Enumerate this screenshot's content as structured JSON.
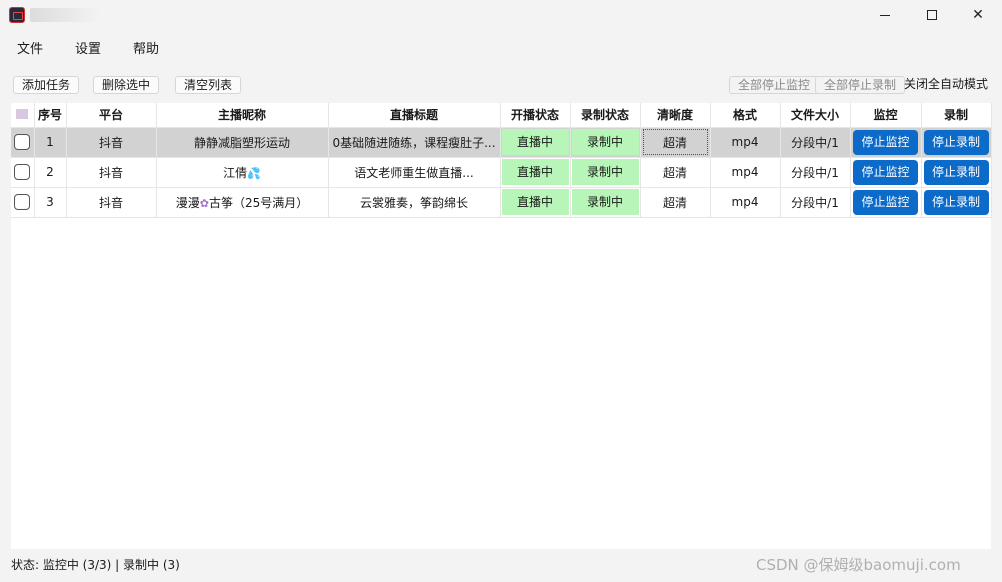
{
  "window": {
    "minimize_icon": "minimize-icon",
    "maximize_icon": "maximize-icon",
    "close_icon": "close-icon"
  },
  "menu": {
    "file": "文件",
    "settings": "设置",
    "help": "帮助"
  },
  "toolbar": {
    "add_task": "添加任务",
    "delete_selected": "删除选中",
    "clear_list": "清空列表",
    "stop_all_monitor": "全部停止监控",
    "stop_all_record": "全部停止录制",
    "close_auto_mode": "关闭全自动模式"
  },
  "table": {
    "headers": [
      "序号",
      "平台",
      "主播昵称",
      "直播标题",
      "开播状态",
      "录制状态",
      "清晰度",
      "格式",
      "文件大小",
      "监控",
      "录制"
    ],
    "rows": [
      {
        "index": "1",
        "platform": "抖音",
        "nickname": "静静减脂塑形运动",
        "nickname_emoji": "",
        "nickname_suffix": "",
        "title": "0基础随进随练，课程瘦肚子...",
        "live_status": "直播中",
        "record_status": "录制中",
        "quality": "超清",
        "format": "mp4",
        "size": "分段中/1",
        "monitor_btn": "停止监控",
        "record_btn": "停止录制"
      },
      {
        "index": "2",
        "platform": "抖音",
        "nickname": "江倩",
        "nickname_emoji": "💦",
        "nickname_suffix": "",
        "title": "语文老师重生做直播...",
        "live_status": "直播中",
        "record_status": "录制中",
        "quality": "超清",
        "format": "mp4",
        "size": "分段中/1",
        "monitor_btn": "停止监控",
        "record_btn": "停止录制"
      },
      {
        "index": "3",
        "platform": "抖音",
        "nickname": "漫漫",
        "nickname_emoji": "✿",
        "nickname_suffix": "古筝（25号满月）",
        "title": "云裳雅奏，筝韵绵长",
        "live_status": "直播中",
        "record_status": "录制中",
        "quality": "超清",
        "format": "mp4",
        "size": "分段中/1",
        "monitor_btn": "停止监控",
        "record_btn": "停止录制"
      }
    ]
  },
  "status": {
    "text": "状态: 监控中 (3/3) | 录制中 (3)"
  },
  "watermark": "CSDN @保姆级baomuji.com",
  "colors": {
    "accent_button": "#0c6ac8",
    "status_green": "#b8f5b8",
    "selected_row": "#d2d2d2"
  }
}
